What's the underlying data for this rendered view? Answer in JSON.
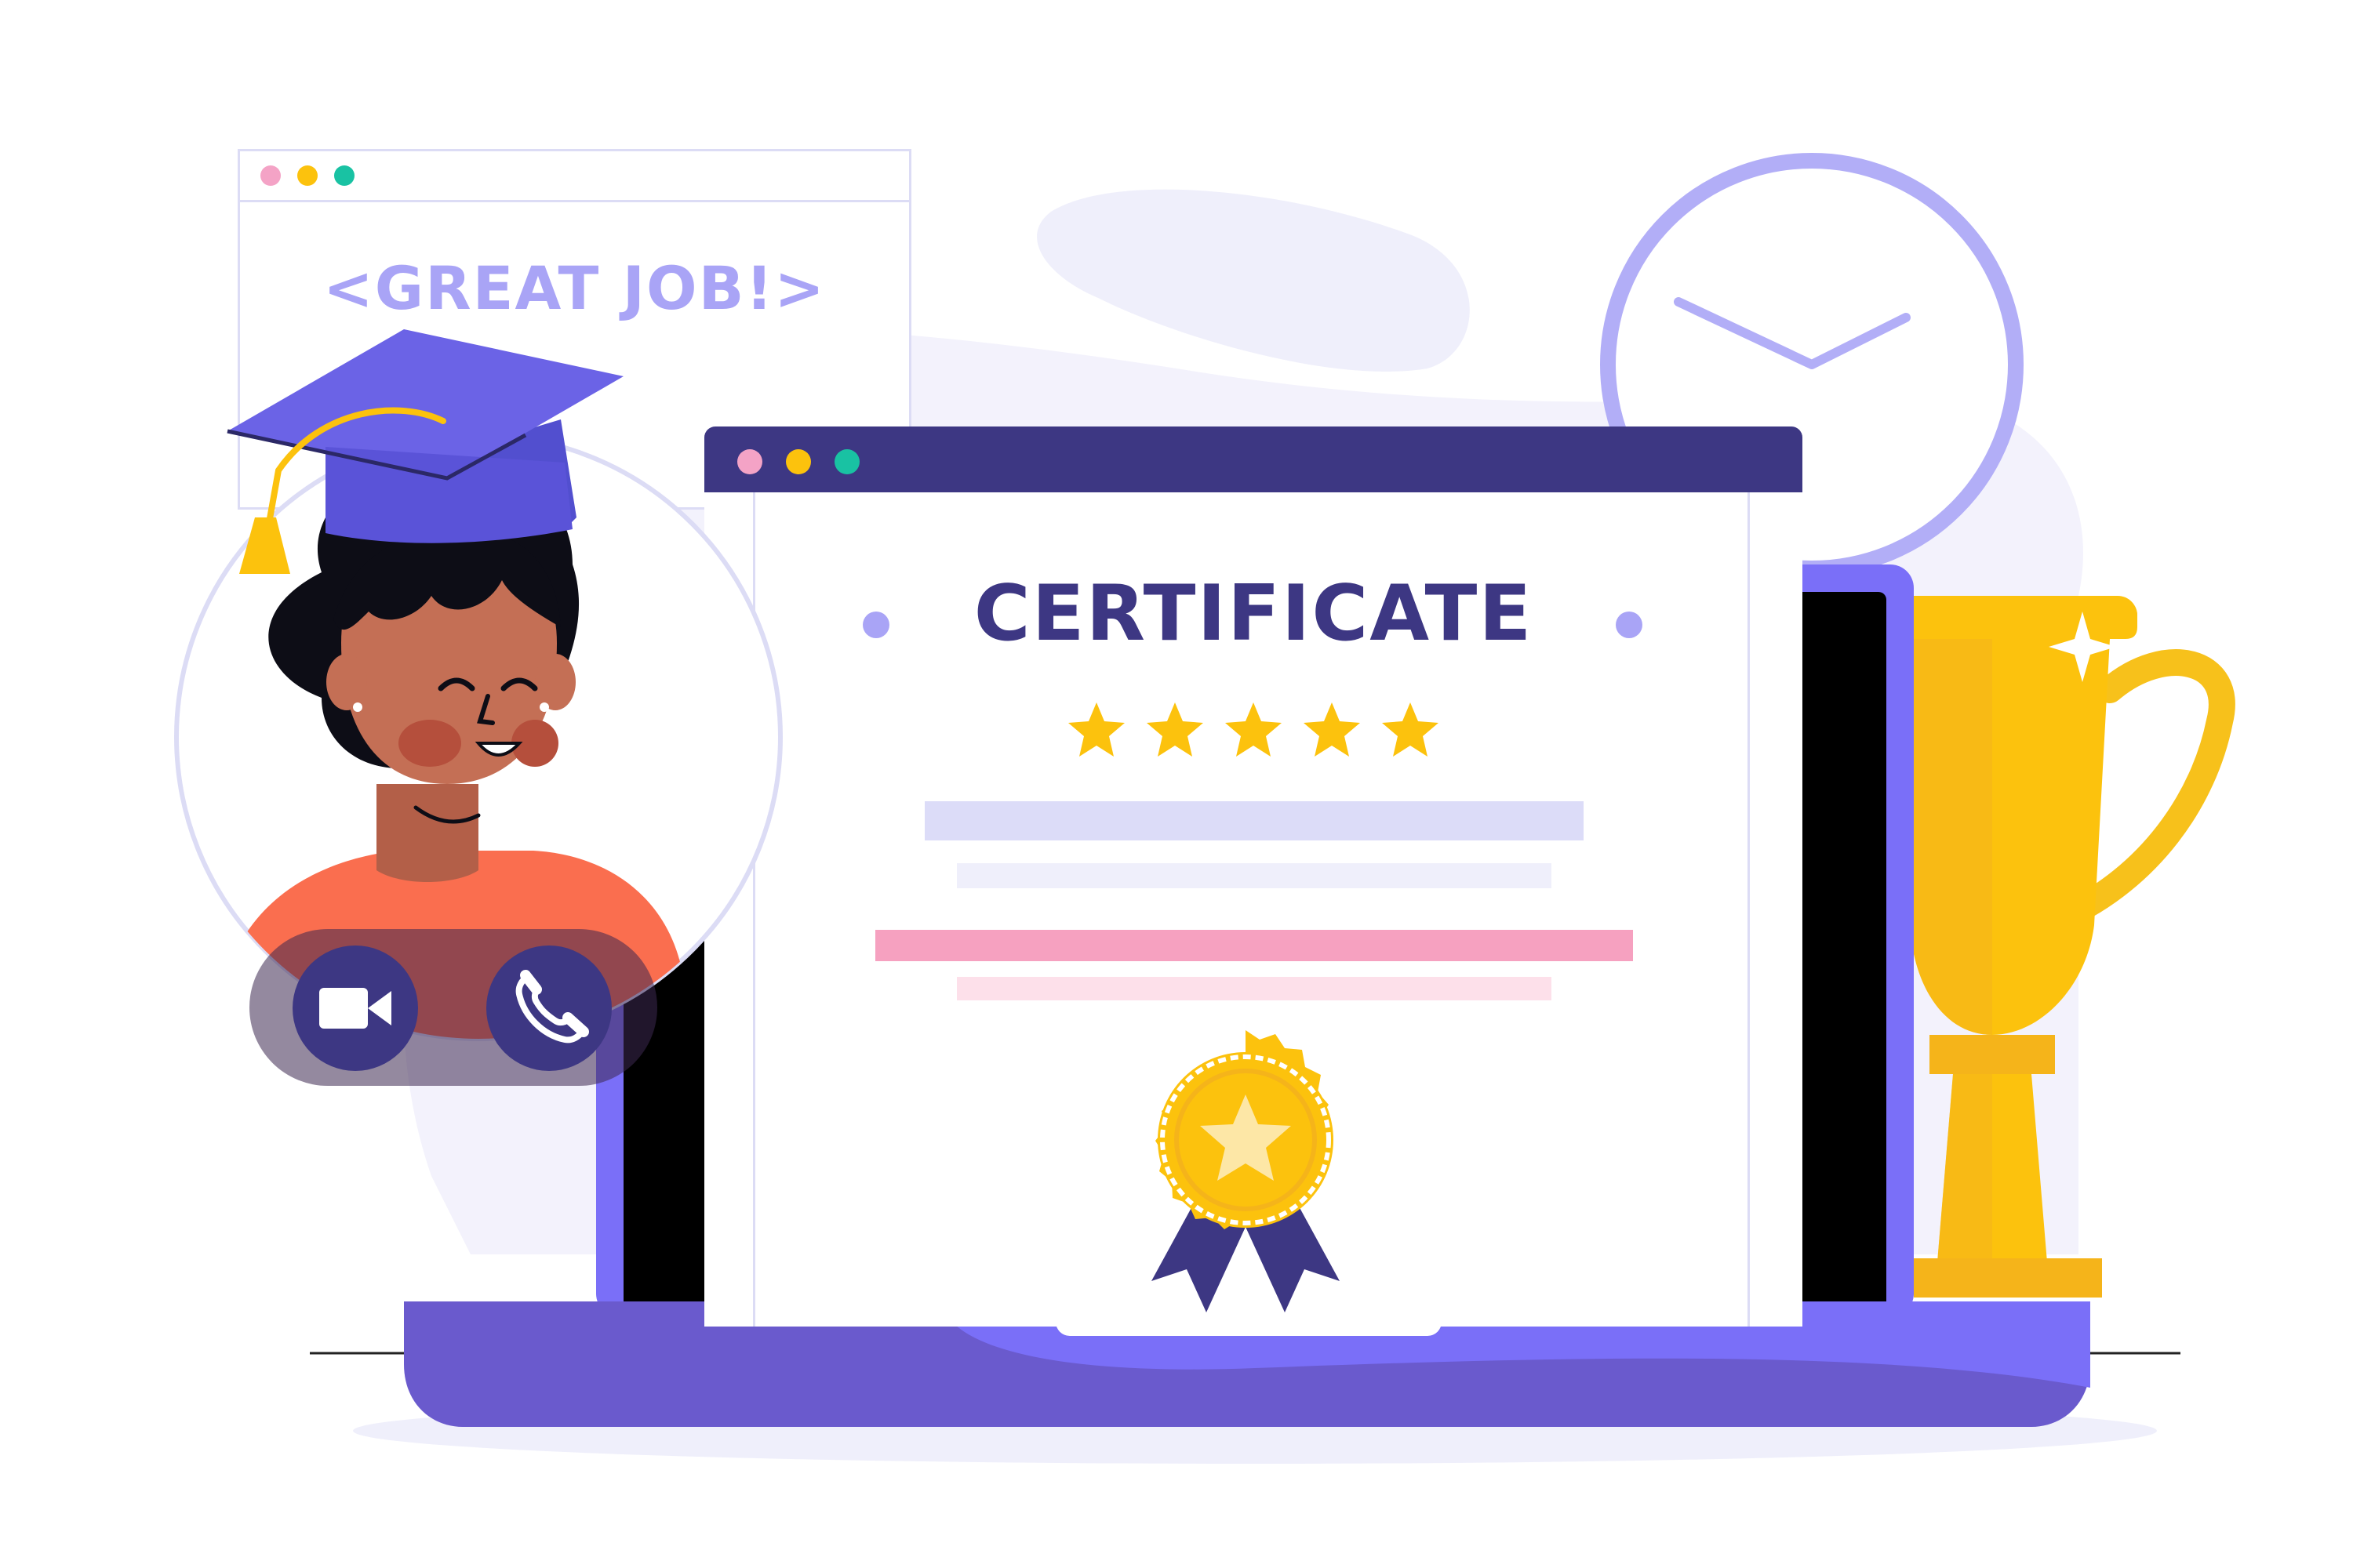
{
  "great_job_window": {
    "title_text": "<GREAT JOB!>",
    "dot_colors": [
      "#f4a3c6",
      "#fcc20d",
      "#19c2a3"
    ]
  },
  "certificate_window": {
    "heading": "CERTIFICATE",
    "rating_stars": 5,
    "dot_colors": [
      "#f4a3c6",
      "#fcc20d",
      "#19c2a3"
    ]
  },
  "call_controls": {
    "video_icon": "video-camera-icon",
    "phone_icon": "phone-icon"
  },
  "colors": {
    "navy": "#3d3783",
    "purple": "#7a6ff8",
    "laptop_base": "#6a5acd",
    "gold": "#fcc20d",
    "lavender": "#a9a4f6",
    "pink_line": "#f6a1c0",
    "skin": "#c46f55",
    "shirt": "#fa6e4f"
  }
}
